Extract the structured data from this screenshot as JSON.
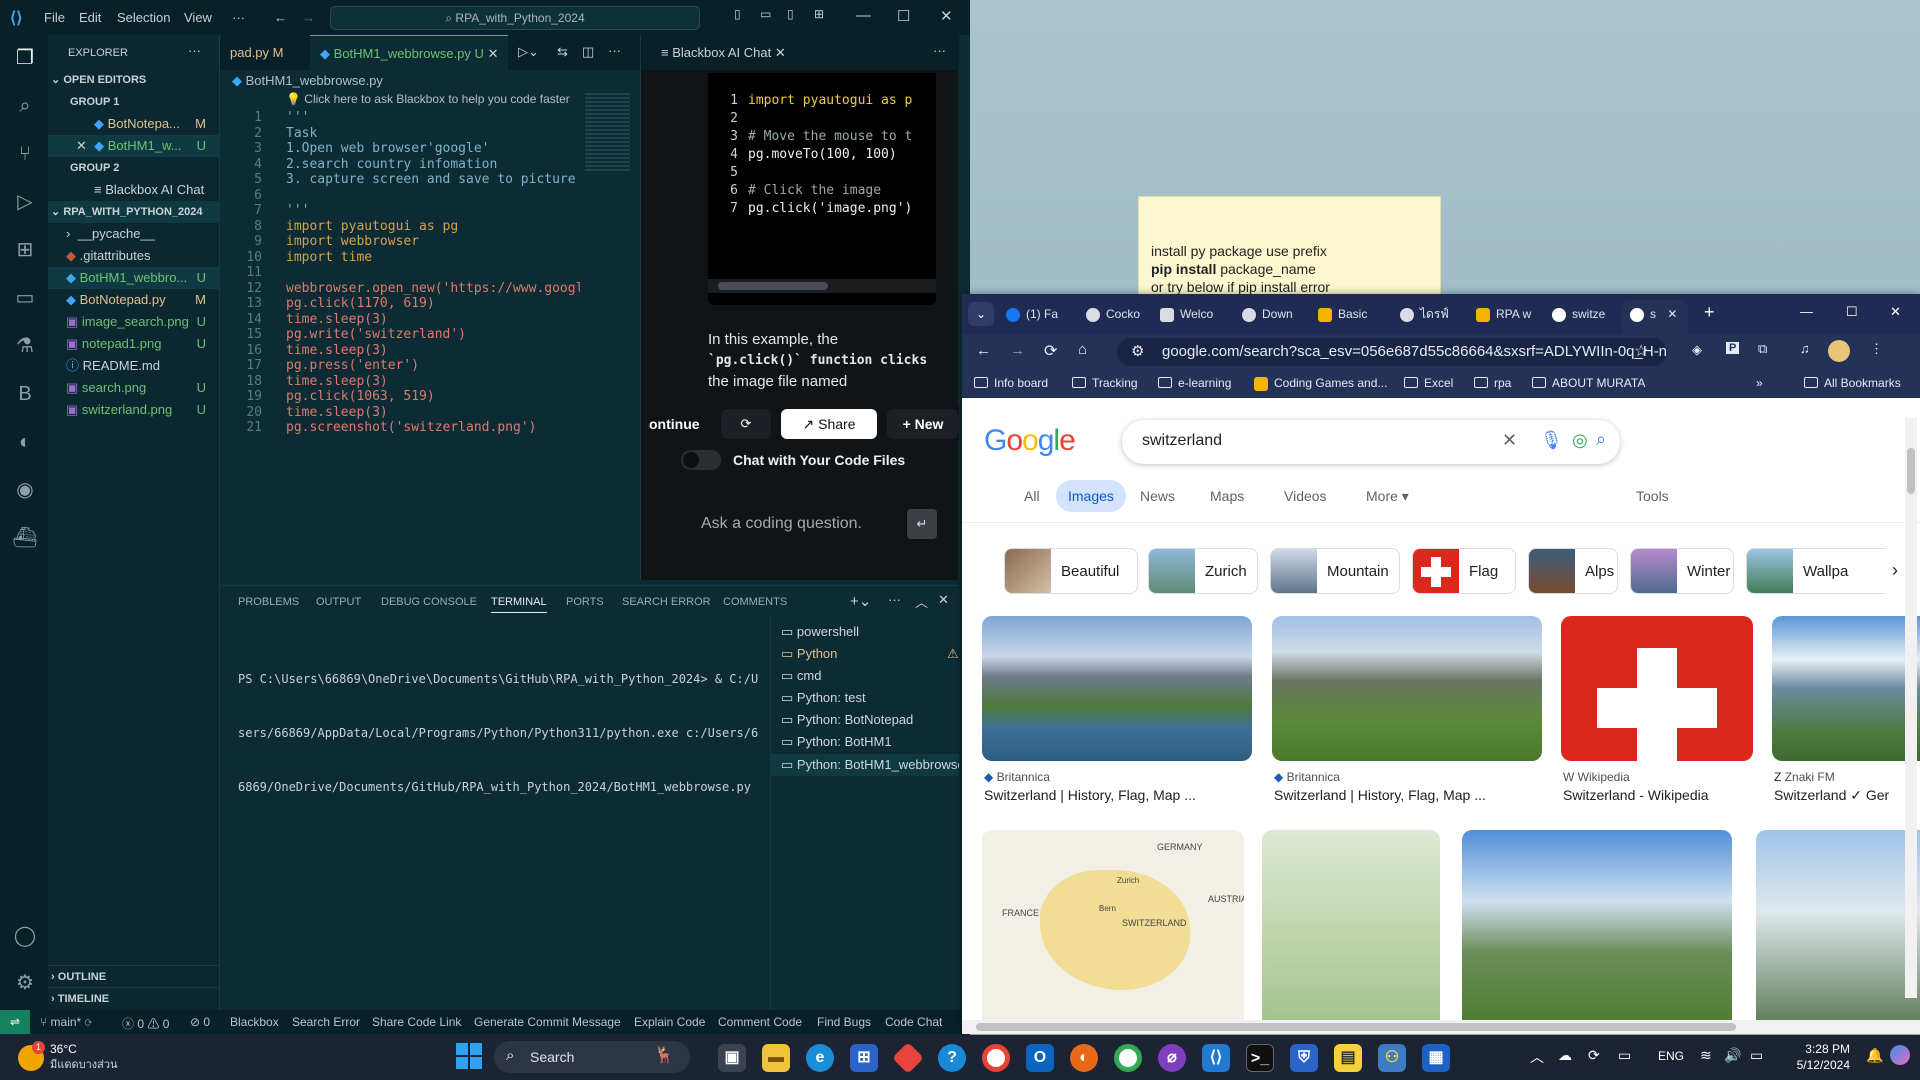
{
  "vscode": {
    "menu": [
      "File",
      "Edit",
      "Selection",
      "View",
      "···"
    ],
    "search": "RPA_with_Python_2024",
    "explorer": {
      "title": "EXPLORER",
      "open_editors": "OPEN EDITORS",
      "group1": "GROUP 1",
      "group1_files": [
        {
          "name": "BotNotepa...",
          "status": "M"
        },
        {
          "name": "BotHM1_w...",
          "status": "U"
        }
      ],
      "group2": "GROUP 2",
      "group2_files": [
        {
          "name": "Blackbox AI Chat"
        }
      ],
      "project": "RPA_WITH_PYTHON_2024",
      "files": [
        {
          "name": "__pycache__",
          "status": ""
        },
        {
          "name": ".gitattributes",
          "status": ""
        },
        {
          "name": "BotHM1_webbro...",
          "status": "U"
        },
        {
          "name": "BotNotepad.py",
          "status": "M"
        },
        {
          "name": "image_search.png",
          "status": "U"
        },
        {
          "name": "notepad1.png",
          "status": "U"
        },
        {
          "name": "README.md",
          "status": ""
        },
        {
          "name": "search.png",
          "status": "U"
        },
        {
          "name": "switzerland.png",
          "status": "U"
        }
      ],
      "outline": "OUTLINE",
      "timeline": "TIMELINE"
    },
    "tabs": [
      {
        "label": "pad.py",
        "status": "M"
      },
      {
        "label": "BotHM1_webbrowse.py",
        "status": "U"
      }
    ],
    "chat_tab": "Blackbox AI Chat",
    "breadcrumb": "BotHM1_webbrowse.py",
    "codelens": "💡 Click here to ask Blackbox to help you code faster",
    "line_numbers": [
      "1",
      "2",
      "3",
      "4",
      "5",
      "6",
      "7",
      "8",
      "9",
      "10",
      "11",
      "12",
      "13",
      "14",
      "15",
      "16",
      "17",
      "18",
      "19",
      "20",
      "21"
    ],
    "code": [
      "'''",
      "Task",
      "1.Open web browser'google'",
      "2.search country infomation",
      "3. capture screen and save to picture",
      "",
      "'''",
      "import pyautogui as pg",
      "import webbrowser",
      "import time",
      "",
      "webbrowser.open_new('https://www.googl",
      "pg.click(1170, 619)",
      "time.sleep(3)",
      "pg.write('switzerland')",
      "time.sleep(3)",
      "pg.press('enter')",
      "time.sleep(3)",
      "pg.click(1063, 519)",
      "time.sleep(3)",
      "pg.screenshot('switzerland.png')"
    ],
    "chat": {
      "code_lines": [
        "import pyautogui as p",
        "",
        "# Move the mouse to t",
        "pg.moveTo(100, 100)",
        "",
        "# Click the image",
        "pg.click('image.png')"
      ],
      "code_line_numbers": [
        "1",
        "2",
        "3",
        "4",
        "5",
        "6",
        "7"
      ],
      "explanation": [
        "In this example, the",
        "`pg.click()` function clicks",
        "the image file named"
      ],
      "continue_label": "ontinue",
      "share_label": "Share",
      "new_label": "New",
      "toggle_label": "Chat with Your Code Files",
      "input_placeholder": "Ask a coding question."
    },
    "panel": {
      "tabs": [
        "PROBLEMS",
        "OUTPUT",
        "DEBUG CONSOLE",
        "TERMINAL",
        "PORTS",
        "SEARCH ERROR",
        "COMMENTS"
      ],
      "terminal_lines": [
        "PS C:\\Users\\66869\\OneDrive\\Documents\\GitHub\\RPA_with_Python_2024> & C:/U",
        "sers/66869/AppData/Local/Programs/Python/Python311/python.exe c:/Users/6",
        "6869/OneDrive/Documents/GitHub/RPA_with_Python_2024/BotHM1_webbrowse.py"
      ],
      "terminals": [
        "powershell",
        "Python",
        "cmd",
        "Python: test",
        "Python: BotNotepad",
        "Python: BotHM1",
        "Python: BotHM1_webbrowse"
      ]
    },
    "status": {
      "branch": "main*",
      "errors": "0",
      "warnings": "0",
      "ports": "0",
      "items": [
        "Blackbox",
        "Search Error",
        "Share Code Link",
        "Generate Commit Message",
        "Explain Code",
        "Comment Code",
        "Find Bugs",
        "Code Chat"
      ]
    }
  },
  "sticky": {
    "line1": "install py package use prefix",
    "line2_bold": "pip install",
    "line2_rest": " package_name",
    "line3": "or try below if pip install error"
  },
  "chrome": {
    "tabs": [
      "(1) Fa",
      "Cocko",
      "Welco",
      "Down",
      "Basic",
      "ไดรฟ์",
      "RPA w",
      "switze",
      "s"
    ],
    "url": "google.com/search?sca_esv=056e687d55c86664&sxsrf=ADLYWIIn-0q_H-nl...",
    "bookmarks": [
      "Info board",
      "Tracking",
      "e-learning",
      "Coding Games and...",
      "Excel",
      "rpa",
      "ABOUT MURATA"
    ],
    "all_bookmarks": "All Bookmarks",
    "search_query": "switzerland",
    "search_tabs": [
      "All",
      "Images",
      "News",
      "Maps",
      "Videos",
      "More"
    ],
    "tools": "Tools",
    "chips": [
      "Beautiful",
      "Zurich",
      "Mountain",
      "Flag",
      "Alps",
      "Winter",
      "Wallpa"
    ],
    "results": [
      {
        "source": "Britannica",
        "title": "Switzerland | History, Flag, Map ..."
      },
      {
        "source": "Britannica",
        "title": "Switzerland | History, Flag, Map ..."
      },
      {
        "source": "Wikipedia",
        "title": "Switzerland - Wikipedia"
      },
      {
        "source": "Znaki FM",
        "title": "Switzerland ✓ Ger"
      }
    ],
    "map_labels": [
      "GERMANY",
      "FRANCE",
      "AUSTRIA",
      "SWITZERLAND",
      "Zurich",
      "Bern"
    ]
  },
  "taskbar": {
    "temp": "36°C",
    "weather": "มีแดดบางส่วน",
    "search": "Search",
    "lang": "ENG",
    "time": "3:28 PM",
    "date": "5/12/2024"
  },
  "colors": {
    "vscode_bg": "#0c2b34",
    "accent_blue": "#1a73e8",
    "swiss_red": "#da291c"
  }
}
